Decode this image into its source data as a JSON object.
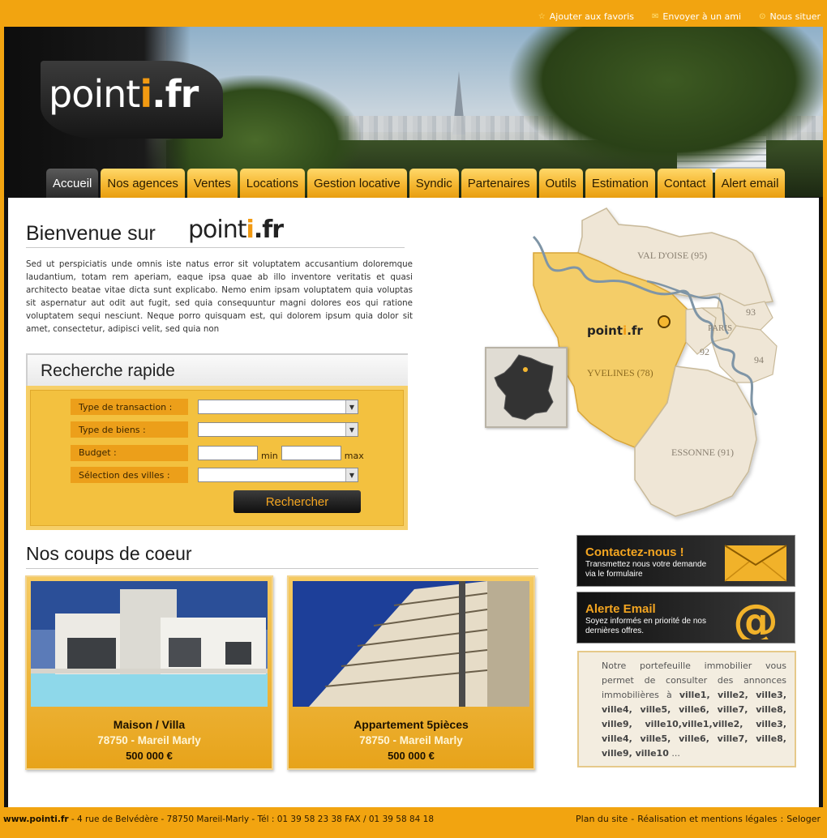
{
  "toplinks": {
    "favoris": "Ajouter aux favoris",
    "ami": "Envoyer à un ami",
    "situer": "Nous situer"
  },
  "logo": {
    "point": "point",
    "i": "i",
    "fr": ".fr"
  },
  "nav": [
    "Accueil",
    "Nos agences",
    "Ventes",
    "Locations",
    "Gestion locative",
    "Syndic",
    "Partenaires",
    "Outils",
    "Estimation",
    "Contact",
    "Alert email"
  ],
  "welcome": {
    "title": "Bienvenue sur",
    "brand_point": "point",
    "brand_i": "i",
    "brand_fr": ".fr"
  },
  "intro": "Sed ut perspiciatis unde omnis iste natus error sit voluptatem accusantium doloremque laudantium, totam rem aperiam, eaque ipsa quae ab illo inventore veritatis et quasi architecto beatae vitae dicta sunt explicabo. Nemo enim ipsam voluptatem quia voluptas sit aspernatur aut odit aut fugit, sed quia consequuntur magni dolores eos qui ratione voluptatem sequi nesciunt. Neque porro quisquam est, qui dolorem ipsum quia dolor sit amet, consectetur, adipisci velit, sed quia non",
  "search": {
    "title": "Recherche rapide",
    "labels": {
      "transaction": "Type de transaction :",
      "biens": "Type de biens :",
      "budget": "Budget :",
      "villes": "Sélection des villes :"
    },
    "min": "min",
    "max": "max",
    "button": "Rechercher"
  },
  "map": {
    "val_doise": "VAL D'OISE (95)",
    "yvelines": "YVELINES (78)",
    "essonne": "ESSONNE (91)",
    "paris": "PARIS",
    "d93": "93",
    "d92": "92",
    "d94": "94",
    "brand_point": "point",
    "brand_i": "i",
    "brand_fr": ".fr"
  },
  "coeur": {
    "title": "Nos coups de coeur",
    "cards": [
      {
        "type": "Maison / Villa",
        "loc": "78750 -  Mareil Marly",
        "price": "500 000 €"
      },
      {
        "type": "Appartement 5pièces",
        "loc": "78750 - Mareil Marly",
        "price": "500 000 €"
      }
    ]
  },
  "banners": {
    "contact_title": "Contactez-nous !",
    "contact_sub": "Transmettez nous votre demande via le formulaire",
    "alert_title": "Alerte Email",
    "alert_sub": "Soyez informés en priorité de nos dernières offres."
  },
  "portfolio": {
    "text": "Notre portefeuille immobilier vous permet de consulter des annonces immobilières à",
    "cities": "ville1, ville2, ville3, ville4, ville5, ville6, ville7, ville8, ville9, ville10,ville1,ville2, ville3, ville4, ville5, ville6, ville7, ville8, ville9, ville10",
    "ellipsis": "..."
  },
  "footer": {
    "site": "www.pointi.fr",
    "address": " - 4 rue de Belvédère - 78750 Mareil-Marly - Tél : 01 39 58 23 38 FAX / 01 39 58 84 18",
    "plan": "Plan du site",
    "sep": " - ",
    "mentions": "Réalisation et mentions légales",
    "colon": " : ",
    "seloger": "Seloger"
  },
  "colors": {
    "brand_orange": "#f2a410",
    "dark": "#111111",
    "accent": "#f29a12"
  }
}
